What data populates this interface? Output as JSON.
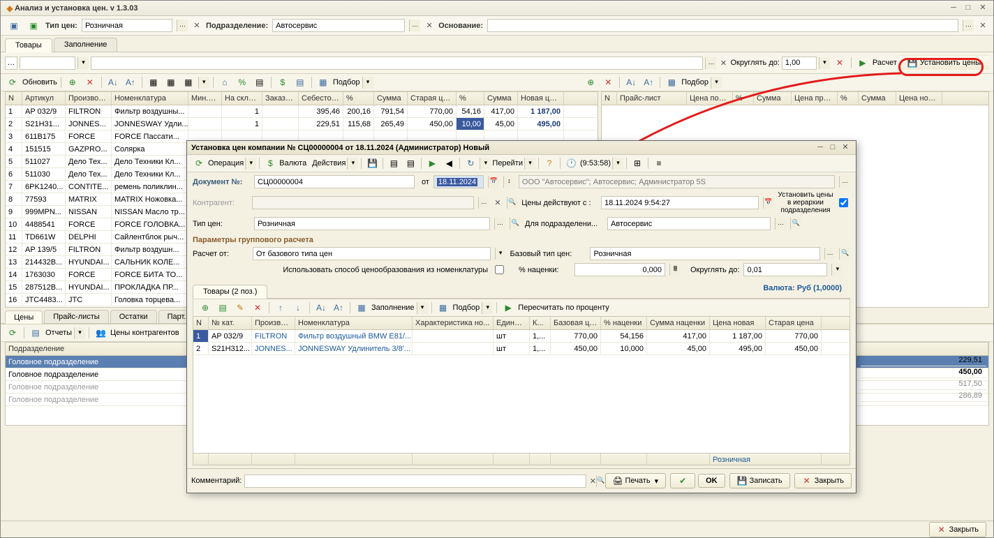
{
  "title": "Анализ и установка цен. v 1.3.03",
  "header": {
    "tip_cen_label": "Тип цен:",
    "tip_cen_value": "Розничная",
    "podrazdelenie_label": "Подразделение:",
    "podrazdelenie_value": "Автосервис",
    "osnovanie_label": "Основание:",
    "osnovanie_value": ""
  },
  "tabs": {
    "tovary": "Товары",
    "zapolnenie": "Заполнение"
  },
  "round": {
    "okruglyat_do": "Округлять до:",
    "value": "1,00",
    "raschet": "Расчет",
    "ustanovit": "Установить цены"
  },
  "tools": {
    "obnovit": "Обновить",
    "podbor": "Подбор"
  },
  "grid_main": {
    "cols": [
      "N",
      "Артикул",
      "Производ...",
      "Номенклатура",
      "Мин.ост",
      "На складе",
      "Заказано",
      "Себестоим...",
      "%",
      "Сумма",
      "Старая цена",
      "%",
      "Сумма",
      "Новая цена"
    ],
    "rows": [
      {
        "n": "1",
        "art": "AP 032/9",
        "prod": "FILTRON",
        "nom": "Фильтр воздушны...",
        "min": "",
        "stock": "1",
        "zak": "",
        "seb": "395,46",
        "p1": "200,16",
        "s1": "791,54",
        "old": "770,00",
        "p2": "54,16",
        "s2": "417,00",
        "new": "1 187,00"
      },
      {
        "n": "2",
        "art": "S21H31...",
        "prod": "JONNES...",
        "nom": "JONNESWAY Удли...",
        "min": "",
        "stock": "1",
        "zak": "",
        "seb": "229,51",
        "p1": "115,68",
        "s1": "265,49",
        "old": "450,00",
        "p2": "10,00",
        "s2": "45,00",
        "new": "495,00"
      },
      {
        "n": "3",
        "art": "611B175",
        "prod": "FORCE",
        "nom": "FORCE Пассати..."
      },
      {
        "n": "4",
        "art": "151515",
        "prod": "GAZPRO...",
        "nom": "Солярка"
      },
      {
        "n": "5",
        "art": "511027",
        "prod": "Дело Тех...",
        "nom": "Дело Техники Кл..."
      },
      {
        "n": "6",
        "art": "511030",
        "prod": "Дело Тех...",
        "nom": "Дело Техники Кл..."
      },
      {
        "n": "7",
        "art": "6PK1240...",
        "prod": "CONTITE...",
        "nom": "ремень поликлин..."
      },
      {
        "n": "8",
        "art": "77593",
        "prod": "MATRIX",
        "nom": "MATRIX Ножовка..."
      },
      {
        "n": "9",
        "art": "999MPN...",
        "prod": "NISSAN",
        "nom": "NISSAN Масло тр..."
      },
      {
        "n": "10",
        "art": "4488541",
        "prod": "FORCE",
        "nom": "FORCE ГОЛОВКА..."
      },
      {
        "n": "11",
        "art": "TD661W",
        "prod": "DELPHI",
        "nom": "Сайлентблок рыч..."
      },
      {
        "n": "12",
        "art": "AP 139/5",
        "prod": "FILTRON",
        "nom": "Фильтр воздушн..."
      },
      {
        "n": "13",
        "art": "214432B...",
        "prod": "HYUNDAI...",
        "nom": "САЛЬНИК КОЛЕ..."
      },
      {
        "n": "14",
        "art": "1763030",
        "prod": "FORCE",
        "nom": "FORCE БИТА ТО..."
      },
      {
        "n": "15",
        "art": "287512B...",
        "prod": "HYUNDAI...",
        "nom": "ПРОКЛАДКА ПР..."
      },
      {
        "n": "16",
        "art": "JTC4483...",
        "prod": "JTC",
        "nom": "Головка торцева..."
      }
    ]
  },
  "grid_right": {
    "cols": [
      "N",
      "Прайс-лист",
      "Цена поку...",
      "%",
      "Сумма",
      "Цена прод...",
      "%",
      "Сумма",
      "Цена новая"
    ]
  },
  "btabs": {
    "ceny": "Цены",
    "prajs": "Прайс-листы",
    "ostatki": "Остатки",
    "partii": "Парт..."
  },
  "btoolbar": {
    "otchety": "Отчеты",
    "kontragent": "Цены контрагентов"
  },
  "podlist": {
    "header": "Подразделение",
    "items": [
      "Головное подразделение",
      "Головное подразделение",
      "Головное подразделение",
      "Головное подразделение"
    ]
  },
  "rtotals": [
    "229,51",
    "450,00",
    "517,50",
    "286,89"
  ],
  "dialog": {
    "title": "Установка цен компании № СЦ00000004 от 18.11.2024 (Администратор) Новый",
    "menu": {
      "operaciya": "Операция",
      "valyuta": "Валюта",
      "dejstviya": "Действия",
      "perejti": "Перейти",
      "time": "(9:53:58)"
    },
    "doc_no_label": "Документ №:",
    "doc_no": "СЦ00000004",
    "ot": "от",
    "date": "18.11.2024",
    "org": "ООО \"Автосервис\"; Автосервис; Администратор 5S",
    "kontragent_label": "Контрагент:",
    "ceny_dejstvuyut_label": "Цены действуют с :",
    "ceny_dejstvuyut": "18.11.2024  9:54:27",
    "ustanovit_ierarhii": "Установить цены в иерархии подразделения",
    "tip_cen_label": "Тип цен:",
    "tip_cen": "Розничная",
    "dlya_podr_label": "Для подразделени...",
    "dlya_podr": "Автосервис",
    "params_header": "Параметры группового расчета",
    "raschet_ot_label": "Расчет от:",
    "raschet_ot": "От базового типа цен",
    "bazovyj_label": "Базовый тип цен:",
    "bazovyj": "Розничная",
    "ispolzovat": "Использовать способ ценообразования из номенклатуры",
    "nacenki_label": "% наценки:",
    "nacenki": "0,000",
    "okruglyat_label": "Округлять до:",
    "okruglyat": "0,01",
    "tab_tovary": "Товары (2 поз.)",
    "currency": "Валюта: Руб (1,0000)",
    "zapolnenie": "Заполнение",
    "podbor": "Подбор",
    "perechitat": "Пересчитать по проценту",
    "gcols": [
      "N",
      "№ кат.",
      "Производ...",
      "Номенклатура",
      "Характеристика но...",
      "Единица",
      "К...",
      "Базовая це...",
      "% наценки",
      "Сумма наценки",
      "Цена новая",
      "Старая цена"
    ],
    "grows": [
      {
        "n": "1",
        "kat": "AP 032/9",
        "prod": "FILTRON",
        "nom": "Фильтр воздушный BMW E81/...",
        "har": "",
        "ed": "шт",
        "k": "1,...",
        "baz": "770,00",
        "pn": "54,156",
        "sn": "417,00",
        "new": "1 187,00",
        "old": "770,00"
      },
      {
        "n": "2",
        "kat": "S21H312...",
        "prod": "JONNES...",
        "nom": "JONNESWAY Удлинитель 3/8'...",
        "har": "",
        "ed": "шт",
        "k": "1,...",
        "baz": "450,00",
        "pn": "10,000",
        "sn": "45,00",
        "new": "495,00",
        "old": "450,00"
      }
    ],
    "foot_type": "Розничная",
    "kommentarij_label": "Комментарий:",
    "pechat": "Печать",
    "ok": "OK",
    "zapisat": "Записать",
    "zakryt": "Закрыть"
  },
  "footer": {
    "zakryt": "Закрыть"
  }
}
